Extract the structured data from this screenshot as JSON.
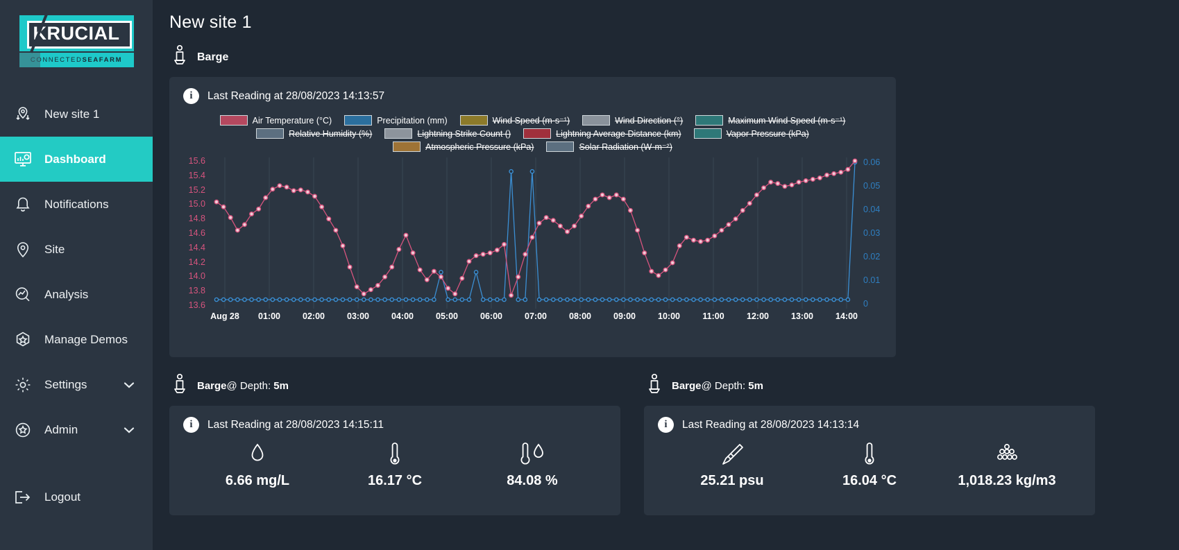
{
  "brand": {
    "logo_main": "KRUCIAL",
    "logo_sub_light": "CONNECTED ",
    "logo_sub_bold": "SEAFARM"
  },
  "sidebar": {
    "items": [
      {
        "label": "New site 1",
        "icon": "map-pin-down-icon",
        "active": false,
        "chevron": false
      },
      {
        "label": "Dashboard",
        "icon": "dashboard-icon",
        "active": true,
        "chevron": false
      },
      {
        "label": "Notifications",
        "icon": "bell-icon",
        "active": false,
        "chevron": false
      },
      {
        "label": "Site",
        "icon": "map-pin-icon",
        "active": false,
        "chevron": false
      },
      {
        "label": "Analysis",
        "icon": "analysis-icon",
        "active": false,
        "chevron": false
      },
      {
        "label": "Manage Demos",
        "icon": "hex-star-icon",
        "active": false,
        "chevron": false
      },
      {
        "label": "Settings",
        "icon": "gear-icon",
        "active": false,
        "chevron": true
      },
      {
        "label": "Admin",
        "icon": "circle-star-icon",
        "active": false,
        "chevron": true
      }
    ],
    "logout": {
      "label": "Logout",
      "icon": "logout-icon"
    }
  },
  "header": {
    "title": "New site 1"
  },
  "weather_section": {
    "asset_label": "Barge",
    "asset_icon": "buoy-icon",
    "last_reading": "Last Reading at 28/08/2023 14:13:57",
    "info_icon": "info-icon"
  },
  "chart_data": {
    "type": "line",
    "title": "",
    "xlabel": "",
    "ylabel": "",
    "grid": true,
    "legend_position": "top",
    "legend": [
      {
        "label": "Air Temperature (°C)",
        "color": "#b5485f",
        "enabled": true
      },
      {
        "label": "Precipitation (mm)",
        "color": "#2b6f9e",
        "enabled": true
      },
      {
        "label": "Wind Speed (m·s⁻¹)",
        "color": "#8c7a2a",
        "enabled": false
      },
      {
        "label": "Wind Direction (°)",
        "color": "#8a929b",
        "enabled": false
      },
      {
        "label": "Maximum Wind Speed (m·s⁻¹)",
        "color": "#2e7878",
        "enabled": false
      },
      {
        "label": "Relative Humidity (%)",
        "color": "#5c6f80",
        "enabled": false
      },
      {
        "label": "Lightning Strike Count ()",
        "color": "#8d949c",
        "enabled": false
      },
      {
        "label": "Lightning Average Distance (km)",
        "color": "#a0303c",
        "enabled": false
      },
      {
        "label": "Vapor Pressure (kPa)",
        "color": "#2e7878",
        "enabled": false
      },
      {
        "label": "Atmospheric Pressure (kPa)",
        "color": "#9e7336",
        "enabled": false
      },
      {
        "label": "Solar Radiation (W·m⁻²)",
        "color": "#5c6f80",
        "enabled": false
      }
    ],
    "y_left": {
      "color": "#d6547e",
      "ticks": [
        "15.6",
        "15.4",
        "15.2",
        "15.0",
        "14.8",
        "14.6",
        "14.4",
        "14.2",
        "14.0",
        "13.8",
        "13.6"
      ],
      "min": 13.6,
      "max": 15.6
    },
    "y_right": {
      "color": "#2f7fc1",
      "ticks": [
        "0.06",
        "0.05",
        "0.04",
        "0.03",
        "0.02",
        "0.01",
        "0"
      ],
      "min": 0,
      "max": 0.06
    },
    "x_ticks": [
      "Aug 28",
      "01:00",
      "02:00",
      "03:00",
      "04:00",
      "05:00",
      "06:00",
      "07:00",
      "08:00",
      "09:00",
      "10:00",
      "11:00",
      "12:00",
      "13:00",
      "14:00"
    ],
    "series": [
      {
        "name": "Air Temperature (°C)",
        "axis": "left",
        "color": "#d6547e",
        "values": [
          15.02,
          14.95,
          14.8,
          14.62,
          14.7,
          14.85,
          14.92,
          15.08,
          15.2,
          15.25,
          15.23,
          15.18,
          15.19,
          15.16,
          15.1,
          14.95,
          14.78,
          14.62,
          14.4,
          14.1,
          13.82,
          13.72,
          13.78,
          13.84,
          13.96,
          14.1,
          14.35,
          14.55,
          14.3,
          14.06,
          13.92,
          14.04,
          13.96,
          13.8,
          13.72,
          13.94,
          14.18,
          14.26,
          14.28,
          14.3,
          14.34,
          14.42,
          13.7,
          13.96,
          14.28,
          14.52,
          14.72,
          14.8,
          14.76,
          14.68,
          14.6,
          14.68,
          14.82,
          14.96,
          15.06,
          15.12,
          15.08,
          15.12,
          15.06,
          14.9,
          14.62,
          14.3,
          14.04,
          13.98,
          14.06,
          14.16,
          14.4,
          14.52,
          14.48,
          14.46,
          14.48,
          14.54,
          14.62,
          14.7,
          14.78,
          14.9,
          15.0,
          15.12,
          15.22,
          15.3,
          15.28,
          15.24,
          15.26,
          15.3,
          15.32,
          15.34,
          15.36,
          15.4,
          15.42,
          15.44,
          15.48,
          15.6
        ]
      },
      {
        "name": "Precipitation (mm)",
        "axis": "right",
        "color": "#3b8fd4",
        "values": [
          0,
          0,
          0,
          0,
          0,
          0,
          0,
          0,
          0,
          0,
          0,
          0,
          0,
          0,
          0,
          0,
          0,
          0,
          0,
          0,
          0,
          0,
          0,
          0,
          0,
          0,
          0,
          0,
          0,
          0,
          0,
          0,
          0.012,
          0,
          0,
          0,
          0,
          0.012,
          0,
          0,
          0,
          0.0,
          0.056,
          0,
          0,
          0.056,
          0,
          0,
          0,
          0,
          0,
          0,
          0,
          0,
          0,
          0,
          0,
          0,
          0,
          0,
          0,
          0,
          0,
          0,
          0,
          0,
          0,
          0,
          0,
          0,
          0,
          0,
          0,
          0,
          0,
          0,
          0,
          0,
          0,
          0,
          0,
          0,
          0,
          0,
          0,
          0,
          0,
          0,
          0,
          0,
          0,
          0.06
        ]
      }
    ]
  },
  "bottom_cards": [
    {
      "asset_label": "Barge",
      "asset_icon": "buoy-icon",
      "depth_prefix": "@ Depth: ",
      "depth_value": "5m",
      "info_icon": "info-icon",
      "last_reading": "Last Reading at 28/08/2023 14:15:11",
      "metrics": [
        {
          "icon": "droplet-icon",
          "value": "6.66 mg/L"
        },
        {
          "icon": "thermometer-icon",
          "value": "16.17 °C"
        },
        {
          "icon": "thermometer-droplet-icon",
          "value": "84.08 %"
        }
      ]
    },
    {
      "asset_label": "Barge",
      "asset_icon": "buoy-icon",
      "depth_prefix": "@ Depth: ",
      "depth_value": "5m",
      "info_icon": "info-icon",
      "last_reading": "Last Reading at 28/08/2023 14:13:14",
      "metrics": [
        {
          "icon": "salinity-icon",
          "value": "25.21 psu"
        },
        {
          "icon": "thermometer-icon",
          "value": "16.04 °C"
        },
        {
          "icon": "density-icon",
          "value": "1,018.23 kg/m3"
        }
      ]
    }
  ],
  "colors": {
    "accent_teal": "#23cbc4",
    "sidebar_bg": "#2b3541",
    "main_bg": "#1f2833",
    "card_bg": "#2b3541"
  }
}
